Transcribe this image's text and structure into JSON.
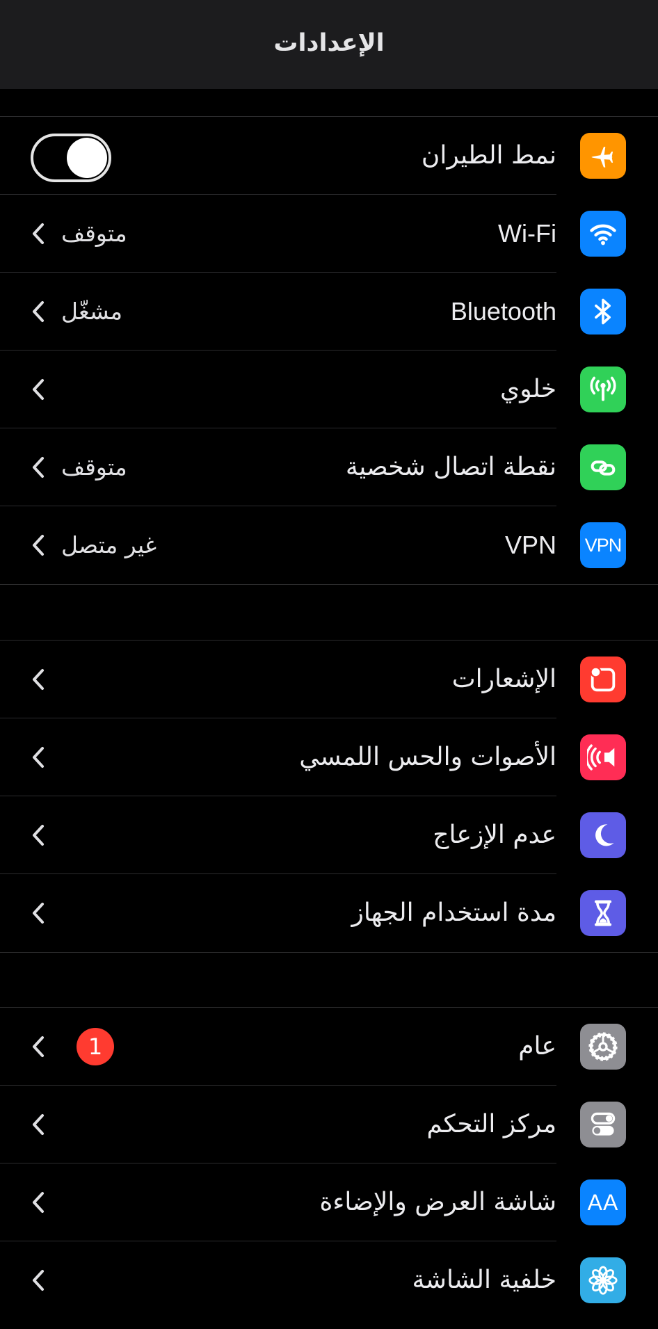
{
  "header": {
    "title": "الإعدادات"
  },
  "groups": {
    "connectivity": {
      "airplane": {
        "label": "نمط الطيران",
        "toggle_on": false
      },
      "wifi": {
        "label": "Wi-Fi",
        "value": "متوقف"
      },
      "bluetooth": {
        "label": "Bluetooth",
        "value": "مشغّل"
      },
      "cellular": {
        "label": "خلوي"
      },
      "hotspot": {
        "label": "نقطة اتصال شخصية",
        "value": "متوقف"
      },
      "vpn": {
        "label": "VPN",
        "value": "غير متصل",
        "icon_text": "VPN"
      }
    },
    "notifications": {
      "notifications": {
        "label": "الإشعارات"
      },
      "sounds": {
        "label": "الأصوات والحس اللمسي"
      },
      "dnd": {
        "label": "عدم الإزعاج"
      },
      "screen_time": {
        "label": "مدة استخدام الجهاز"
      }
    },
    "general": {
      "general": {
        "label": "عام",
        "badge": "1"
      },
      "control_center": {
        "label": "مركز التحكم"
      },
      "display": {
        "label": "شاشة العرض والإضاءة",
        "icon_text": "AA"
      },
      "wallpaper": {
        "label": "خلفية الشاشة"
      }
    }
  },
  "icons": {
    "airplane": "airplane-icon",
    "wifi": "wifi-icon",
    "bluetooth": "bluetooth-icon",
    "cellular": "cellular-antenna-icon",
    "hotspot": "hotspot-chain-icon",
    "vpn": "vpn-icon",
    "notifications": "notifications-icon",
    "sounds": "speaker-icon",
    "dnd": "moon-icon",
    "screen_time": "hourglass-icon",
    "general": "gear-icon",
    "control_center": "switches-icon",
    "display": "text-size-icon",
    "wallpaper": "flower-icon",
    "chevron": "chevron-left-icon"
  },
  "colors": {
    "orange": "#ff9500",
    "blue": "#0a84ff",
    "green": "#30d158",
    "red": "#ff3b30",
    "pink": "#ff2d55",
    "indigo": "#5e5ce6",
    "gray": "#8e8e93"
  }
}
